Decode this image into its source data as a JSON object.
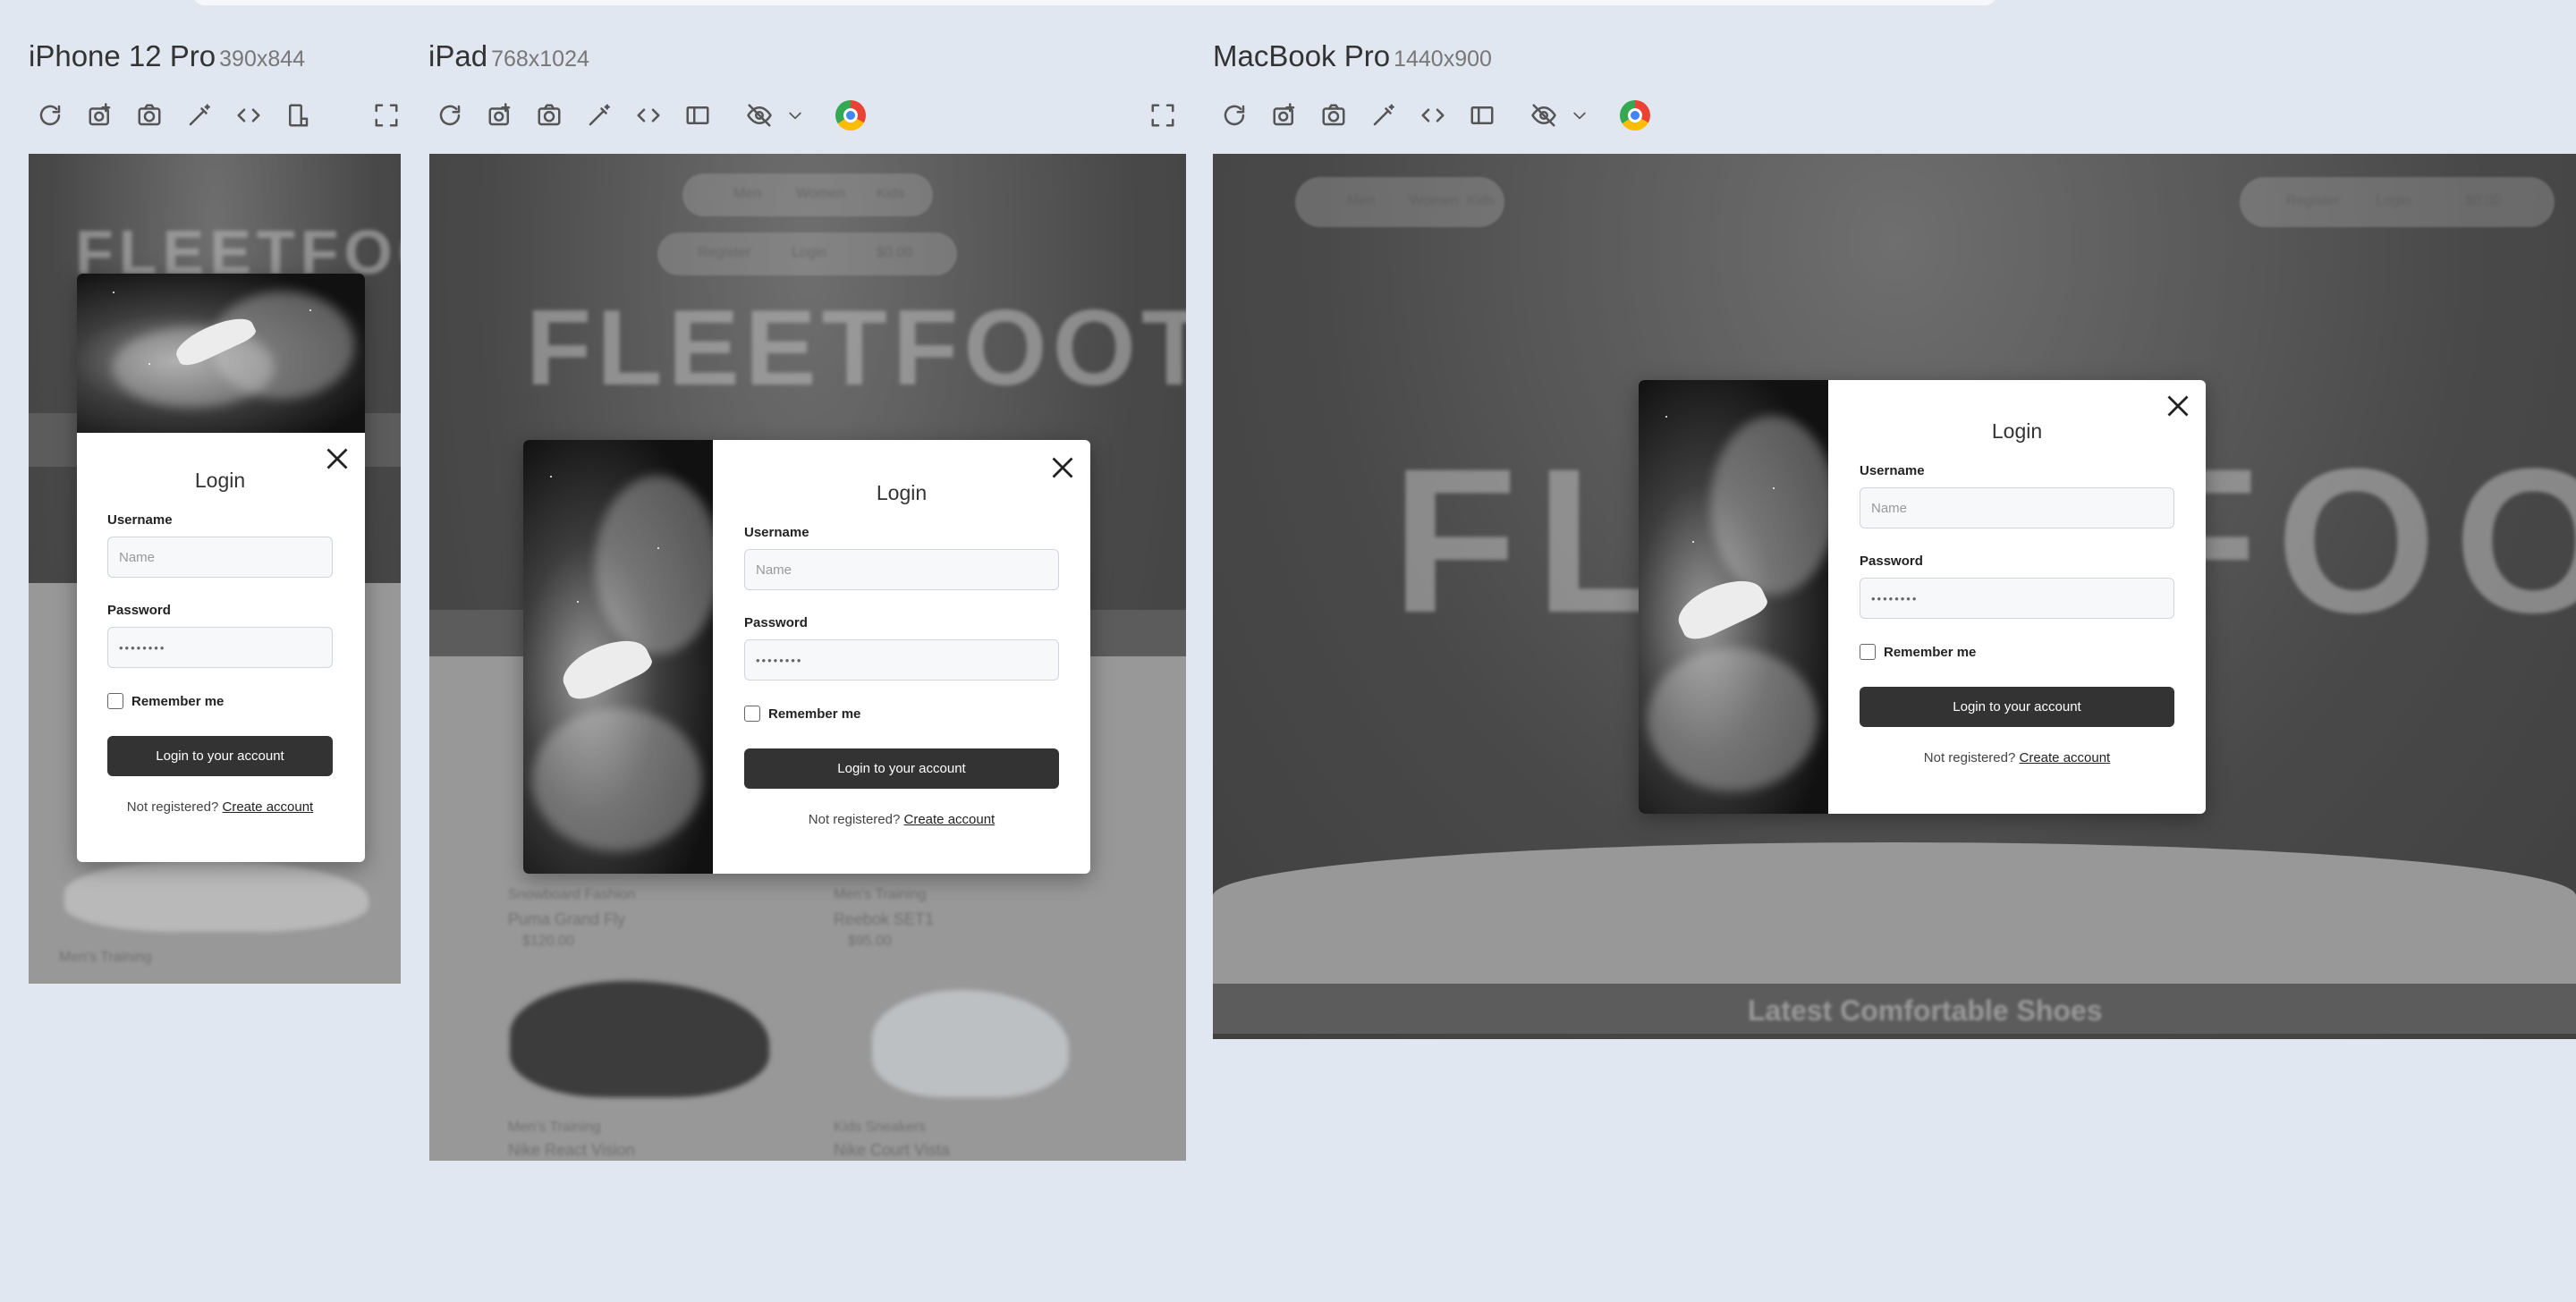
{
  "devices": [
    {
      "name": "iPhone 12 Pro",
      "size": "390x844"
    },
    {
      "name": "iPad",
      "size": "768x1024"
    },
    {
      "name": "MacBook Pro",
      "size": "1440x900"
    }
  ],
  "toolbar_icons": [
    "refresh-icon",
    "screenshot-full-icon",
    "camera-icon",
    "wand-icon",
    "code-icon",
    "rotate-device-icon",
    "hide-icon",
    "chevron-down-icon",
    "color-blind-icon",
    "fullscreen-icon"
  ],
  "page": {
    "brand": "FLEETFOOT",
    "nav": [
      "Men",
      "Women",
      "Kids"
    ],
    "actions": [
      "Register",
      "Login",
      "$0.00"
    ],
    "section_title": "Latest Comfortable Shoes",
    "products": [
      {
        "brand": "Snowboard Fashion",
        "name": "Puma Grand Fly",
        "price": "$120.00"
      },
      {
        "brand": "Men's Training",
        "name": "Reebok SET1",
        "price": "$95.00"
      },
      {
        "brand": "Men's Training",
        "name": "Nike React Vision",
        "price": ""
      },
      {
        "brand": "Kids Sneakers",
        "name": "Nike Court Vista",
        "price": ""
      }
    ]
  },
  "login": {
    "title": "Login",
    "username_label": "Username",
    "username_placeholder": "Name",
    "password_label": "Password",
    "password_value": "••••••••",
    "remember_label": "Remember me",
    "submit_label": "Login to your account",
    "register_prompt": "Not registered?",
    "register_link": "Create account"
  }
}
